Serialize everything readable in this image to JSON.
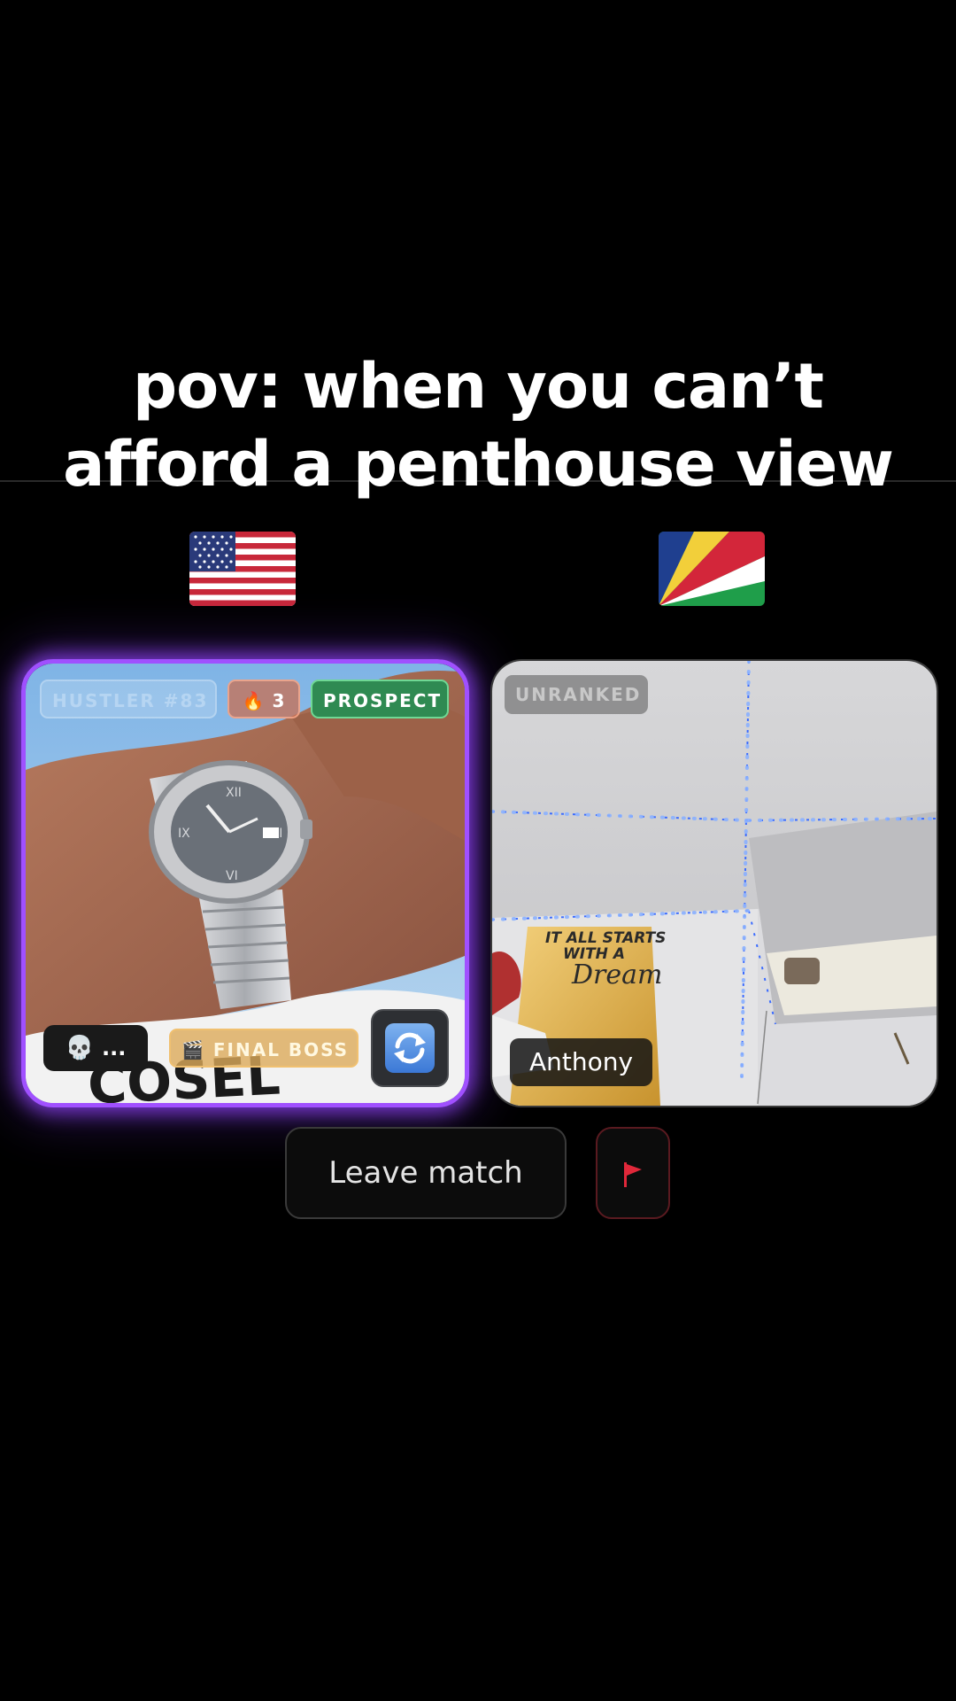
{
  "caption": {
    "line1": "pov: when you can’t",
    "line2": "afford a penthouse view"
  },
  "flags": {
    "left": "flag-usa",
    "right": "flag-seychelles"
  },
  "left_player": {
    "rank_label": "HUSTLER #83",
    "streak_emoji": "🔥",
    "streak_count": "3",
    "tier_label": "PROSPECT",
    "skull_emoji": "💀",
    "skull_more": "...",
    "title_emoji": "🎬",
    "title_label": "FINAL BOSS",
    "swap_icon": "swap-camera-icon",
    "accent_color": "#a050ff"
  },
  "right_player": {
    "rank_label": "UNRANKED",
    "name": "Anthony",
    "poster_line1": "IT ALL STARTS",
    "poster_line2": "WITH A",
    "poster_line3": "Dream"
  },
  "actions": {
    "leave_label": "Leave match",
    "report_icon": "flag-icon",
    "report_color": "#e0283a"
  }
}
